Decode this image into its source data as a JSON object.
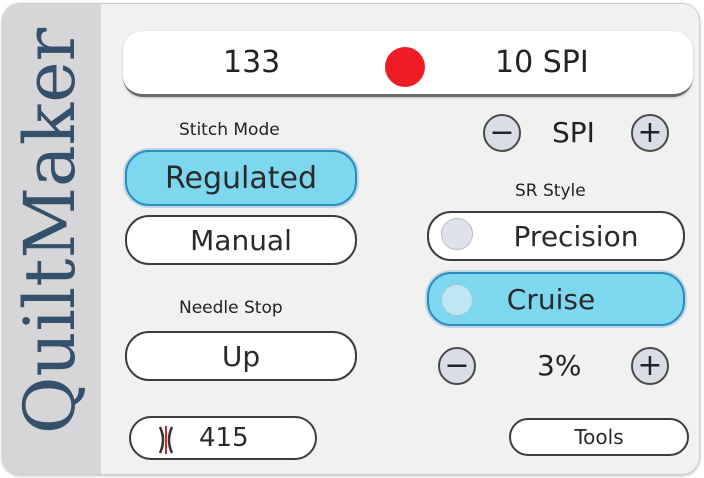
{
  "brand": "QuiltMaker",
  "status": {
    "stitch_count": "133",
    "spi_readout": "10 SPI",
    "indicator_color": "#ee1d25"
  },
  "stitch_mode": {
    "label": "Stitch Mode",
    "options": [
      "Regulated",
      "Manual"
    ],
    "selected": "Regulated"
  },
  "needle_stop": {
    "label": "Needle Stop",
    "value": "Up"
  },
  "needle_counter": {
    "icon": "needle-icon",
    "value": "415"
  },
  "spi_control": {
    "label": "SPI",
    "minus": "−",
    "plus": "+"
  },
  "sr_style": {
    "label": "SR Style",
    "options": [
      "Precision",
      "Cruise"
    ],
    "selected": "Cruise"
  },
  "percent_control": {
    "value": "3%",
    "minus": "−",
    "plus": "+"
  },
  "tools_button": "Tools",
  "colors": {
    "accent": "#7dd8ef",
    "accent_border": "#2b8cc0",
    "sidebar": "#d6d6d8",
    "brand_text": "#35506a"
  }
}
